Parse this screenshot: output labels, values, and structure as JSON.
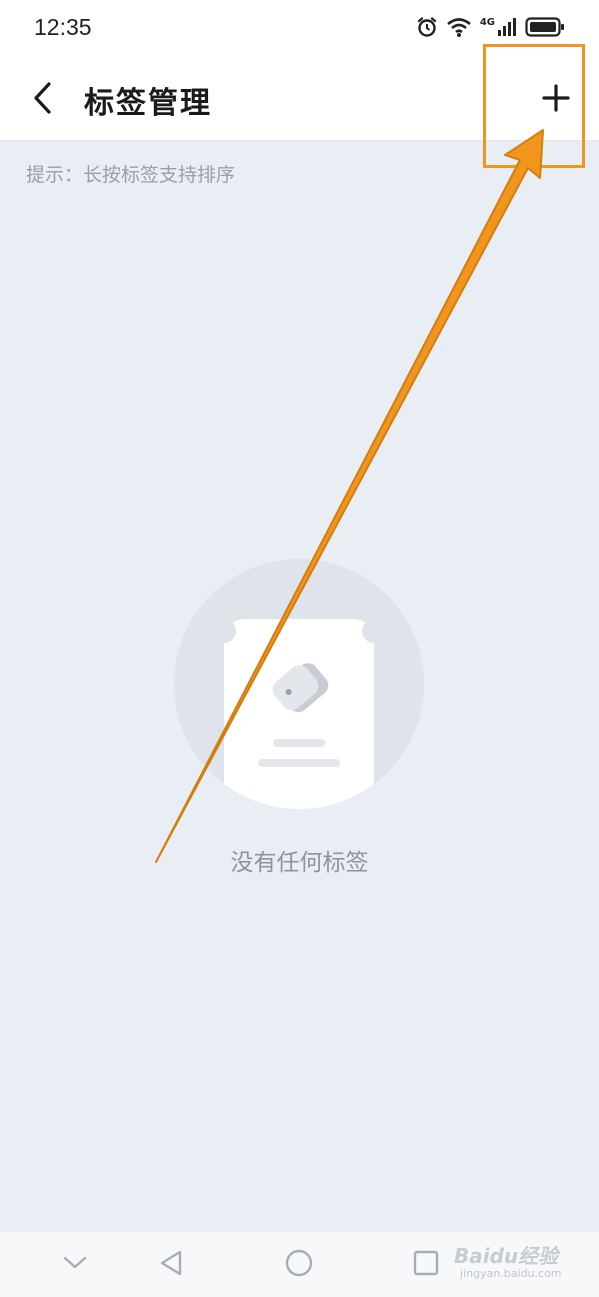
{
  "status_bar": {
    "time": "12:35",
    "network_label": "4G",
    "icons": [
      "alarm-icon",
      "wifi-icon",
      "signal-icon",
      "battery-icon"
    ]
  },
  "app_bar": {
    "title": "标签管理",
    "back_icon": "chevron-left-icon",
    "add_icon": "plus-icon"
  },
  "hint": "提示：长按标签支持排序",
  "empty_state": {
    "message": "没有任何标签",
    "illustration": "tag-card-illustration"
  },
  "navigation_bar": {
    "buttons": [
      "chevron-down-icon",
      "back-triangle-icon",
      "home-circle-icon",
      "recents-square-icon"
    ]
  },
  "annotation": {
    "color": "#f0961e"
  },
  "watermark": {
    "logo": "Baidu经验",
    "url": "jingyan.baidu.com"
  }
}
